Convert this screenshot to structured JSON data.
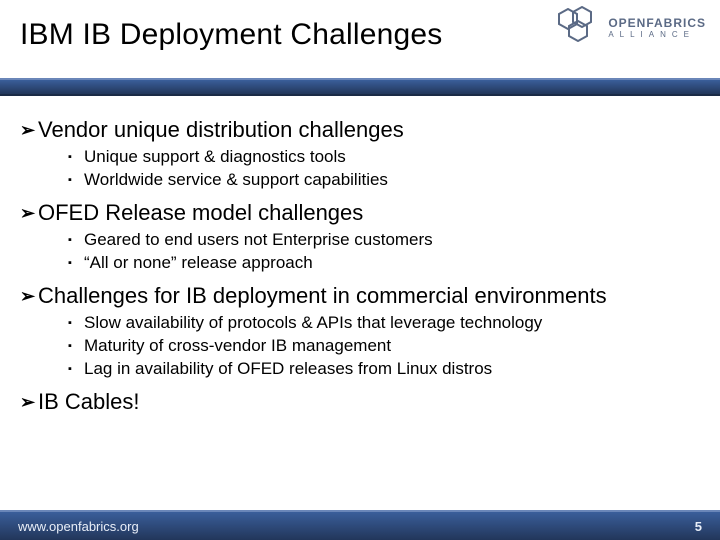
{
  "logo": {
    "top": "OPENFABRICS",
    "bottom": "ALLIANCE"
  },
  "title": "IBM IB Deployment Challenges",
  "bullets": [
    {
      "text": "Vendor unique distribution challenges",
      "sub": [
        "Unique support & diagnostics tools",
        "Worldwide service & support capabilities"
      ]
    },
    {
      "text": "OFED Release model challenges",
      "sub": [
        "Geared to end users not Enterprise customers",
        "“All or none” release approach"
      ]
    },
    {
      "text": "Challenges for IB deployment in commercial environments",
      "sub": [
        "Slow availability of protocols & APIs that leverage technology",
        "Maturity of cross-vendor IB management",
        "Lag in availability of OFED releases from Linux distros"
      ]
    },
    {
      "text": "IB Cables!",
      "sub": []
    }
  ],
  "footer": {
    "url": "www.openfabrics.org",
    "page": "5"
  }
}
